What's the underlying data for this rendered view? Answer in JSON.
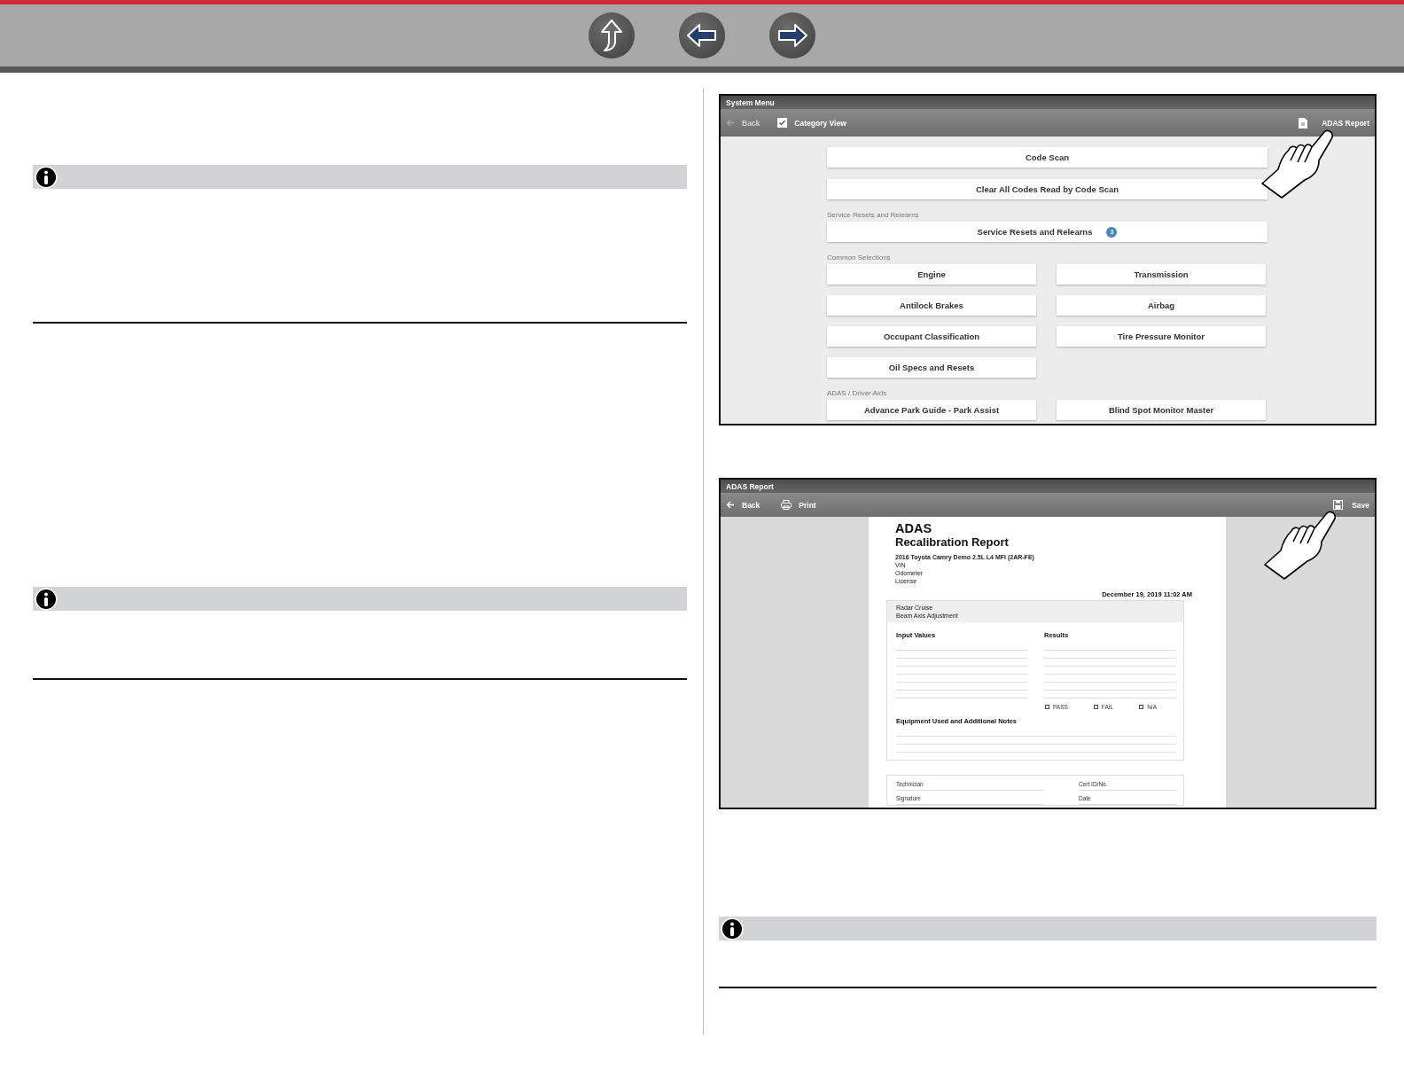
{
  "system_menu": {
    "title": "System Menu",
    "toolbar": {
      "back": {
        "label": "Back",
        "disabled": true
      },
      "category_view": {
        "label": "Category View",
        "checked": true
      },
      "report": {
        "label": "ADAS Report"
      }
    },
    "sections": [
      {
        "kind": "full",
        "items": [
          {
            "label": "Code Scan"
          },
          {
            "label": "Clear All Codes Read by Code Scan"
          }
        ]
      },
      {
        "kind": "full",
        "heading": "Service Resets and Relearns",
        "items": [
          {
            "label": "Service Resets and Relearns",
            "badge": "3"
          }
        ]
      },
      {
        "kind": "grid",
        "heading": "Common Selections",
        "items": [
          {
            "label": "Engine"
          },
          {
            "label": "Transmission"
          },
          {
            "label": "Antilock Brakes"
          },
          {
            "label": "Airbag"
          },
          {
            "label": "Occupant Classification"
          },
          {
            "label": "Tire Pressure Monitor"
          },
          {
            "label": "Oil Specs and Resets"
          }
        ]
      },
      {
        "kind": "grid",
        "heading": "ADAS / Driver Aids",
        "items": [
          {
            "label": "Advance Park Guide - Park Assist"
          },
          {
            "label": "Blind Spot Monitor Master"
          }
        ]
      }
    ]
  },
  "adas_report": {
    "title": "ADAS Report",
    "toolbar": {
      "back": "Back",
      "print": "Print",
      "save": "Save"
    },
    "document": {
      "title": "ADAS",
      "subtitle": "Recalibration Report",
      "vehicle": "2016 Toyota Camry Demo 2.5L L4 MFI (2AR-FE)",
      "fields": [
        "VIN",
        "Odometer",
        "License"
      ],
      "date": "December 19, 2019 11:02 AM",
      "test": {
        "system": "Radar Cruise",
        "procedure": "Beam Axis Adjustment",
        "input_title": "Input Values",
        "results_title": "Results",
        "outcomes": [
          {
            "label": "PASS",
            "checked": false
          },
          {
            "label": "FAIL",
            "checked": false
          },
          {
            "label": "N/A",
            "checked": false
          }
        ],
        "notes_title": "Equipment Used and Additional Notes"
      },
      "signoff": [
        {
          "label": "Technician"
        },
        {
          "label": "Cert ID/No."
        },
        {
          "label": "Signature"
        },
        {
          "label": "Date"
        }
      ]
    }
  }
}
